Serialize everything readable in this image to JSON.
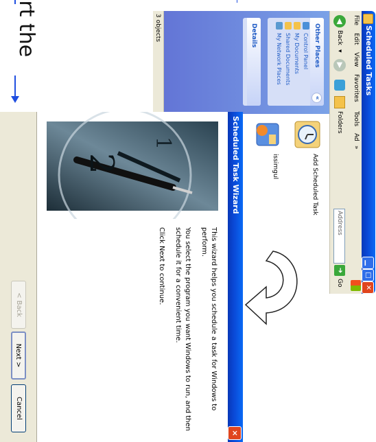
{
  "slide": {
    "caption": "art the"
  },
  "explorer": {
    "title": "Scheduled Tasks",
    "menu": [
      "File",
      "Edit",
      "View",
      "Favorites",
      "Tools",
      "Ad",
      "»"
    ],
    "toolbar": {
      "back": "Back",
      "folders": "Folders",
      "address_label": "Address",
      "go": "Go"
    },
    "other_places": {
      "heading": "Other Places",
      "items": [
        "Control Panel",
        "My Documents",
        "Shared Documents",
        "My Network Places"
      ]
    },
    "details": {
      "heading": "Details"
    },
    "files": [
      {
        "name": "Add Scheduled Task"
      },
      {
        "name": "issimgul"
      }
    ],
    "status": "3 objects"
  },
  "wizard": {
    "title": "Scheduled Task Wizard",
    "paragraphs": [
      "This wizard helps you schedule a task for Windows to perform.",
      "You select the program you want Windows to run, and then schedule it for a convenient time.",
      "Click Next to continue."
    ],
    "buttons": {
      "back": "< Back",
      "next": "Next >",
      "cancel": "Cancel"
    },
    "close": "×"
  },
  "colors": {
    "xp_blue": "#0a48d6",
    "close_red": "#e0451e",
    "slide_line": "#1f4ee0"
  }
}
